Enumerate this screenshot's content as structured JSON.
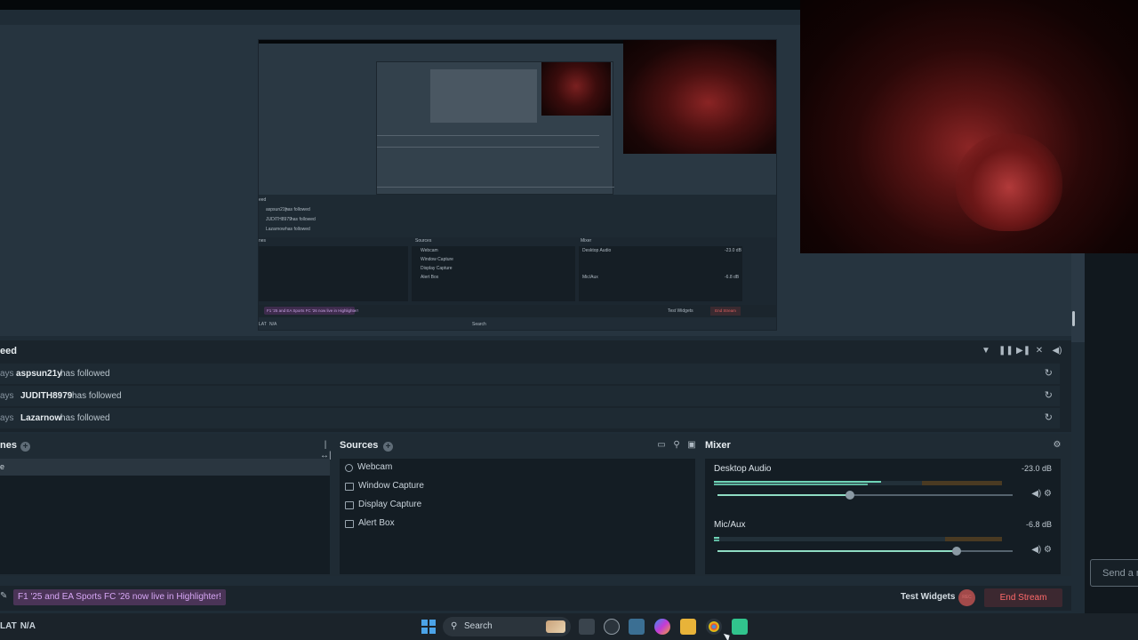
{
  "activity_feed": {
    "title": "eed",
    "items": [
      {
        "ago": "ays",
        "user": "aspsun21y",
        "action": "has followed"
      },
      {
        "ago": "ays",
        "user": "JUDITH8979",
        "action": "has followed"
      },
      {
        "ago": "ays",
        "user": "Lazarnow",
        "action": "has followed"
      }
    ]
  },
  "scenes": {
    "title": "nes",
    "selected": "e"
  },
  "sources": {
    "title": "Sources",
    "items": [
      "Webcam",
      "Window Capture",
      "Display Capture",
      "Alert Box"
    ]
  },
  "mixer": {
    "title": "Mixer",
    "channels": [
      {
        "name": "Desktop Audio",
        "db": "-23.0 dB",
        "meter_level": 0.58,
        "volume": 0.45
      },
      {
        "name": "Mic/Aux",
        "db": "-6.8 dB",
        "meter_level": 0.02,
        "volume": 0.81
      }
    ]
  },
  "bottom_bar": {
    "promo": "F1 '25 and EA Sports FC '26 now live in Highlighter!",
    "test_widgets": "Test Widgets",
    "end_stream": "End Stream"
  },
  "chat": {
    "placeholder": "Send a m"
  },
  "taskbar": {
    "left_label": "LAT",
    "left_value": "N/A",
    "search": "Search"
  },
  "nested_preview": {
    "feed": [
      {
        "user": "aspsun21y",
        "action": "has followed"
      },
      {
        "user": "JUDITH8979",
        "action": "has followed"
      },
      {
        "user": "Lazarnow",
        "action": "has followed"
      }
    ],
    "sources_title": "Sources",
    "mixer_title": "Mixer",
    "sources": [
      "Webcam",
      "Window Capture",
      "Display Capture",
      "Alert Box"
    ],
    "channels": [
      {
        "name": "Desktop Audio",
        "db": "-23.0 dB"
      },
      {
        "name": "Mic/Aux",
        "db": "-6.8 dB"
      }
    ],
    "promo": "F1 '25 and EA Sports FC '26 now live in Highlighter!",
    "test_widgets": "Test Widgets",
    "end_stream": "End Stream",
    "search": "Search",
    "left_label": "LAT",
    "left_value": "N/A"
  },
  "colors": {
    "accent": "#6fd5b6",
    "promo": "#d7a7f5",
    "end_stream": "#ff6a6a"
  }
}
